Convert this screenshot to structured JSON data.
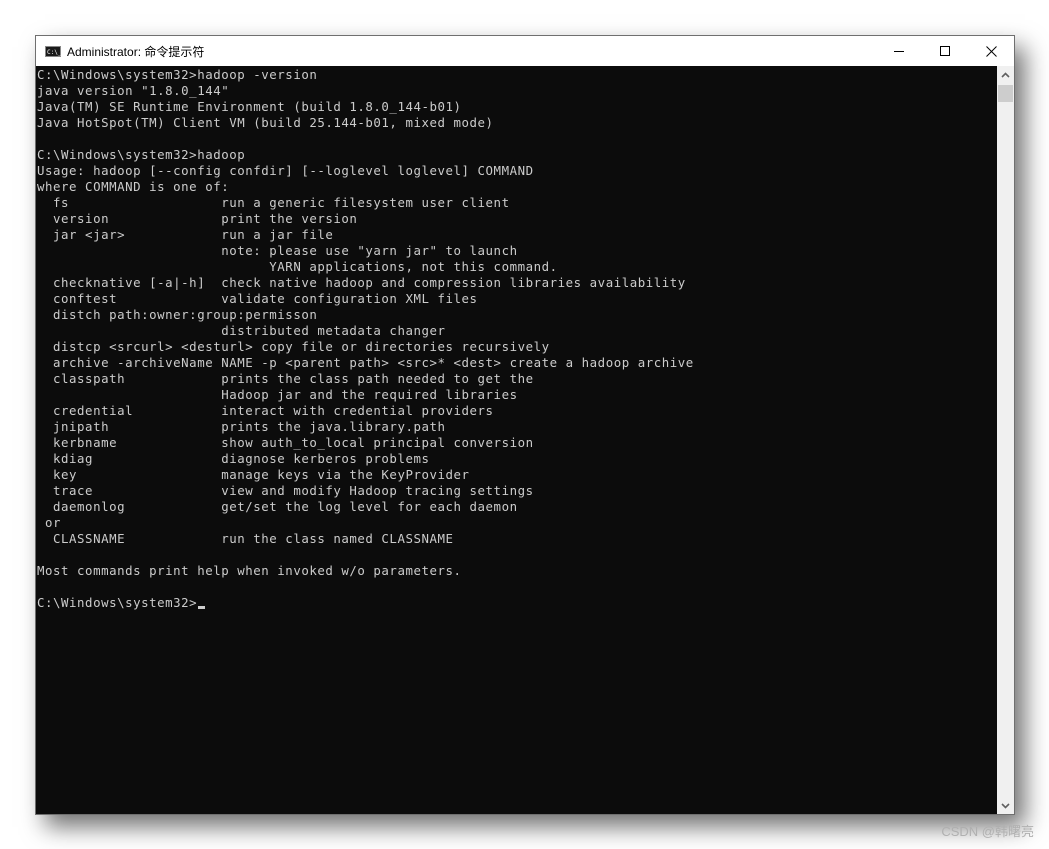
{
  "window": {
    "title": "Administrator: 命令提示符",
    "app_icon_label": "C:\\_",
    "controls": {
      "minimize": "minimize",
      "maximize": "maximize",
      "close": "close"
    }
  },
  "terminal": {
    "lines": [
      "C:\\Windows\\system32>hadoop -version",
      "java version \"1.8.0_144\"",
      "Java(TM) SE Runtime Environment (build 1.8.0_144-b01)",
      "Java HotSpot(TM) Client VM (build 25.144-b01, mixed mode)",
      "",
      "C:\\Windows\\system32>hadoop",
      "Usage: hadoop [--config confdir] [--loglevel loglevel] COMMAND",
      "where COMMAND is one of:",
      "  fs                   run a generic filesystem user client",
      "  version              print the version",
      "  jar <jar>            run a jar file",
      "                       note: please use \"yarn jar\" to launch",
      "                             YARN applications, not this command.",
      "  checknative [-a|-h]  check native hadoop and compression libraries availability",
      "  conftest             validate configuration XML files",
      "  distch path:owner:group:permisson",
      "                       distributed metadata changer",
      "  distcp <srcurl> <desturl> copy file or directories recursively",
      "  archive -archiveName NAME -p <parent path> <src>* <dest> create a hadoop archive",
      "  classpath            prints the class path needed to get the",
      "                       Hadoop jar and the required libraries",
      "  credential           interact with credential providers",
      "  jnipath              prints the java.library.path",
      "  kerbname             show auth_to_local principal conversion",
      "  kdiag                diagnose kerberos problems",
      "  key                  manage keys via the KeyProvider",
      "  trace                view and modify Hadoop tracing settings",
      "  daemonlog            get/set the log level for each daemon",
      " or",
      "  CLASSNAME            run the class named CLASSNAME",
      "",
      "Most commands print help when invoked w/o parameters.",
      ""
    ],
    "prompt": "C:\\Windows\\system32>"
  },
  "watermark": "CSDN @韩曙亮",
  "colors": {
    "terminal_bg": "#0c0c0c",
    "terminal_fg": "#cccccc",
    "titlebar_bg": "#ffffff",
    "scrollbar_bg": "#f0f0f0",
    "scrollbar_thumb": "#cdcdcd"
  }
}
